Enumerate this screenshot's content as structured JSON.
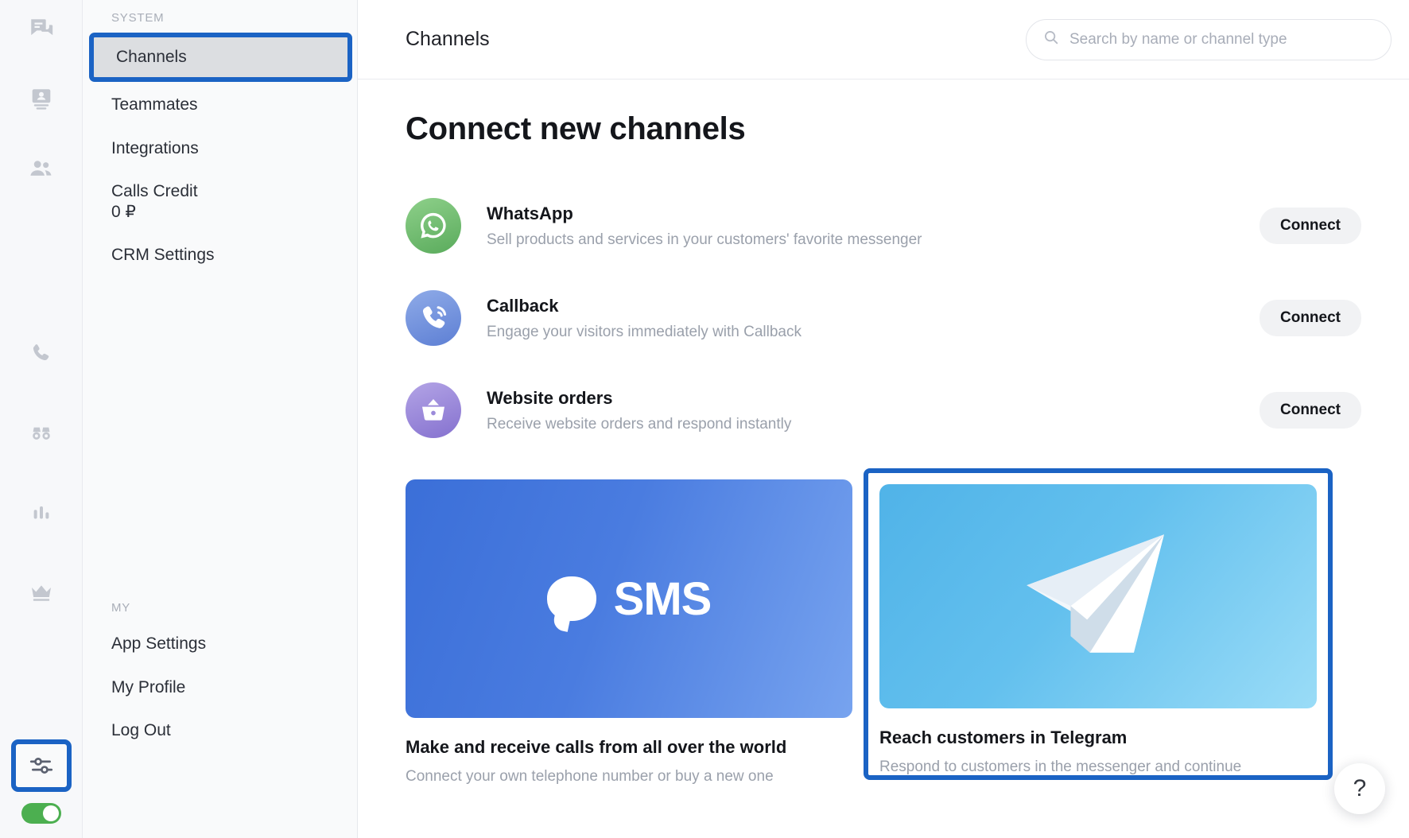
{
  "rail": {
    "items_top": [
      {
        "name": "chats-icon",
        "label": "Chats"
      },
      {
        "name": "contacts-icon",
        "label": "Contacts"
      },
      {
        "name": "customers-icon",
        "label": "Customers"
      }
    ],
    "items_mid": [
      {
        "name": "calls-icon",
        "label": "Calls"
      },
      {
        "name": "monitor-icon",
        "label": "Monitor"
      },
      {
        "name": "analytics-icon",
        "label": "Analytics"
      },
      {
        "name": "crown-icon",
        "label": "Premium"
      }
    ],
    "selected": {
      "name": "settings-sliders-icon",
      "label": "Settings"
    },
    "toggle": {
      "name": "online-status-toggle",
      "state": "on",
      "color": "#4caf50"
    }
  },
  "sidebar": {
    "system_label": "SYSTEM",
    "my_label": "MY",
    "system_items": [
      {
        "label": "Channels",
        "selected": true
      },
      {
        "label": "Teammates",
        "selected": false
      },
      {
        "label": "Integrations",
        "selected": false
      },
      {
        "label": "Calls Credit",
        "sub": "0 ₽",
        "selected": false
      },
      {
        "label": "CRM Settings",
        "selected": false
      }
    ],
    "my_items": [
      {
        "label": "App Settings"
      },
      {
        "label": "My Profile"
      },
      {
        "label": "Log Out"
      }
    ]
  },
  "topbar": {
    "title": "Channels",
    "search": {
      "placeholder": "Search by name or channel type",
      "value": "",
      "icon": "search-icon"
    }
  },
  "main": {
    "page_title": "Connect new channels",
    "connect_label": "Connect",
    "channels": [
      {
        "name": "WhatsApp",
        "description": "Sell products and services in your customers' favorite messenger",
        "icon": "whatsapp-icon",
        "color": "#6fc06f"
      },
      {
        "name": "Callback",
        "description": "Engage your visitors immediately with Callback",
        "icon": "callback-phone-icon",
        "color": "#6f93de"
      },
      {
        "name": "Website orders",
        "description": "Receive website orders and respond instantly",
        "icon": "basket-icon",
        "color": "#9b8ada"
      }
    ],
    "promo_cards": [
      {
        "art": "sms-logo",
        "art_text": "SMS",
        "title": "Make and receive calls from all over the world",
        "description": "Connect your own telephone number or buy a new one",
        "highlighted": false
      },
      {
        "art": "telegram-plane-icon",
        "art_text": "",
        "title": "Reach customers in Telegram",
        "description": "Respond to customers in the messenger and continue communication anytime",
        "highlighted": true
      }
    ]
  },
  "help_button": {
    "label": "?",
    "icon": "question-mark-icon"
  },
  "colors": {
    "highlight_border": "#1b63c4",
    "sidebar_bg": "#f9fafb",
    "selected_item_bg": "#dcdee1",
    "toggle_on": "#4caf50"
  }
}
